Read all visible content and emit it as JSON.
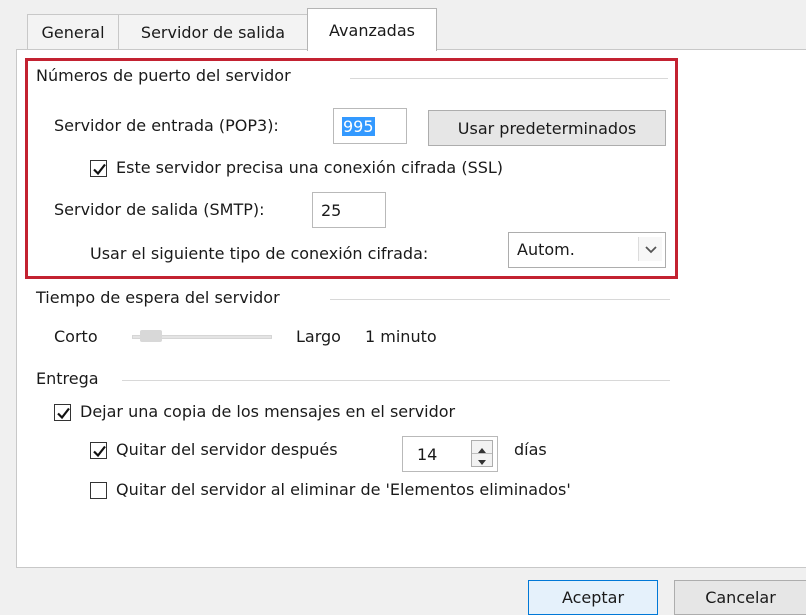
{
  "tabs": [
    {
      "label": "General"
    },
    {
      "label": "Servidor de salida"
    },
    {
      "label": "Avanzadas"
    }
  ],
  "ports_group": {
    "title": "Números de puerto del servidor",
    "incoming_label": "Servidor de entrada (POP3):",
    "incoming_value": "995",
    "defaults_button": "Usar predeterminados",
    "ssl_checkbox_label": "Este servidor precisa una conexión cifrada (SSL)",
    "ssl_checked": true,
    "outgoing_label": "Servidor de salida (SMTP):",
    "outgoing_value": "25",
    "encryption_label": "Usar el siguiente tipo de conexión cifrada:",
    "encryption_value": "Autom."
  },
  "timeout_group": {
    "title": "Tiempo de espera del servidor",
    "short_label": "Corto",
    "long_label": "Largo",
    "value_text": "1 minuto",
    "slider_position": 0
  },
  "delivery_group": {
    "title": "Entrega",
    "leave_copy_label": "Dejar una copia de los mensajes en el servidor",
    "leave_copy_checked": true,
    "remove_after_label": "Quitar del servidor después",
    "remove_after_checked": true,
    "remove_after_value": "14",
    "days_label": "días",
    "remove_deleted_label": "Quitar del servidor al eliminar de 'Elementos eliminados'",
    "remove_deleted_checked": false
  },
  "footer": {
    "ok_button": "Aceptar",
    "cancel_button": "Cancelar"
  },
  "colors": {
    "highlight_border": "#c32231",
    "selection": "#3399ff",
    "primary_button_border": "#0078d7"
  },
  "icons": {
    "checkmark": "check-icon",
    "dropdown": "chevron-down-icon",
    "spin_up": "spin-up-icon",
    "spin_down": "spin-down-icon"
  }
}
